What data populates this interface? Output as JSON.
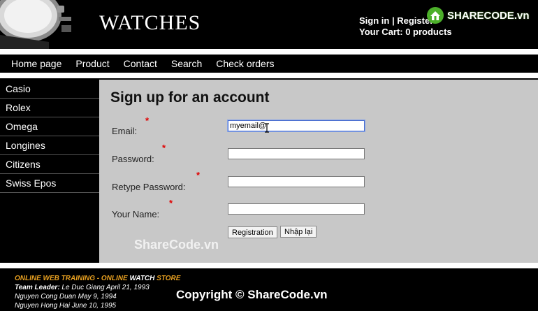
{
  "header": {
    "site_title": "WATCHES",
    "sign_in": "Sign in",
    "separator": "|",
    "register": "Register",
    "cart": "Your Cart: 0 products",
    "logo_text": "SHARECODE.vn"
  },
  "nav": {
    "items": [
      "Home page",
      "Product",
      "Contact",
      "Search",
      "Check orders"
    ]
  },
  "sidebar": {
    "items": [
      "Casio",
      "Rolex",
      "Omega",
      "Longines",
      "Citizens",
      "Swiss Epos"
    ]
  },
  "form": {
    "title": "Sign up for an account",
    "required_mark": "*",
    "email_label": "Email:",
    "email_value": "myemail@",
    "password_label": "Password:",
    "retype_label": "Retype Password:",
    "name_label": "Your Name:",
    "register_button": "Registration",
    "reset_button": "Nhập lại"
  },
  "watermark": "ShareCode.vn",
  "footer": {
    "line1_a": "ONLINE WEB TRAINING - ONLINE ",
    "line1_b": "WATCH",
    "line1_c": " STORE",
    "team_label": "Team Leader:",
    "team_value": " Le Duc Giang April 21, 1993",
    "member1": "Nguyen Cong Duan May 9, 1994",
    "member2": "Nguyen Hong Hai June 10, 1995",
    "copyright": "Copyright © ShareCode.vn"
  },
  "colors": {
    "main_bg": "#c8c8c8",
    "required": "#e00000",
    "footer_accent": "#e8a020"
  }
}
